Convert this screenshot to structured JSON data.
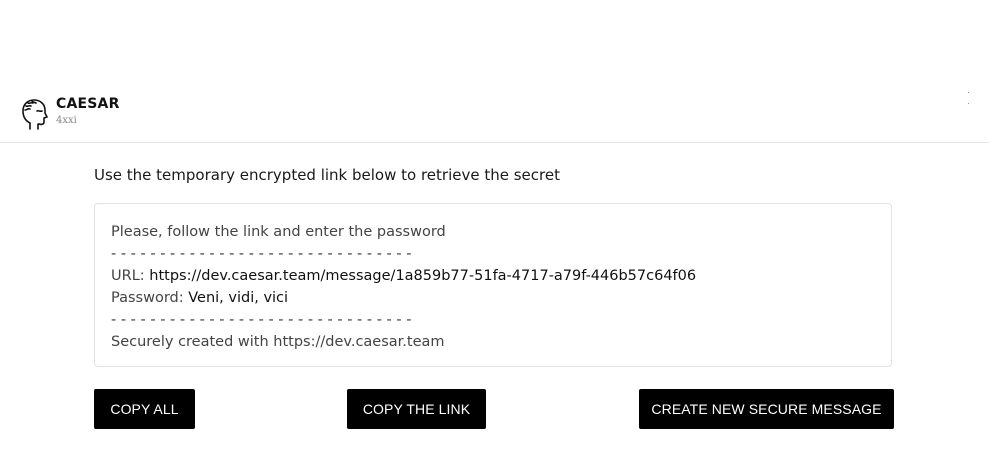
{
  "header": {
    "brand_name": "CAESAR",
    "brand_sub": "4xxi",
    "logo_icon": "caesar-head-icon"
  },
  "main": {
    "instruction": "Use the temporary encrypted link below to retrieve the secret",
    "message": {
      "intro": "Please, follow the link and enter the password",
      "divider": "- - - - - - - - - - - - - - - - - - - - - - - - - - - - - - -",
      "url_label": "URL:",
      "url_value": "https://dev.caesar.team/message/1a859b77-51fa-4717-a79f-446b57c64f06",
      "password_label": "Password:",
      "password_value": "Veni, vidi, vici",
      "footer": "Securely created with https://dev.caesar.team"
    }
  },
  "buttons": {
    "copy_all": "COPY ALL",
    "copy_link": "COPY THE LINK",
    "create_new": "CREATE NEW SECURE MESSAGE"
  },
  "colors": {
    "button_bg": "#000000",
    "button_text": "#ffffff",
    "border": "#e2e2e2"
  }
}
